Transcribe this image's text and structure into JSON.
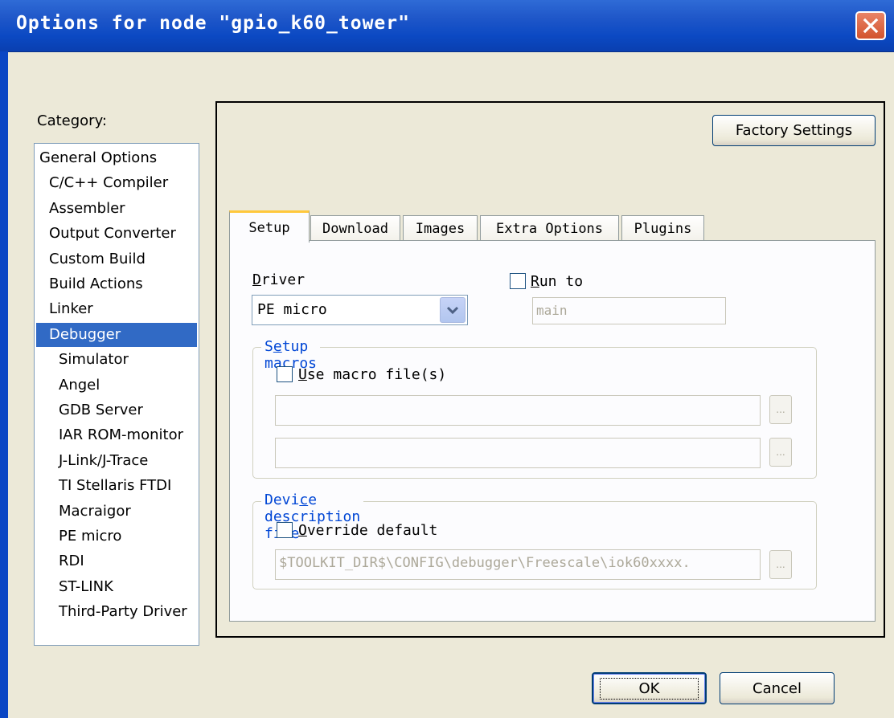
{
  "window": {
    "title": "Options for node \"gpio_k60_tower\""
  },
  "category": {
    "label": "Category:",
    "items": [
      {
        "label": "General Options",
        "indent": 0
      },
      {
        "label": "C/C++ Compiler",
        "indent": 1
      },
      {
        "label": "Assembler",
        "indent": 1
      },
      {
        "label": "Output Converter",
        "indent": 1
      },
      {
        "label": "Custom Build",
        "indent": 1
      },
      {
        "label": "Build Actions",
        "indent": 1
      },
      {
        "label": "Linker",
        "indent": 1
      },
      {
        "label": "Debugger",
        "indent": 1,
        "selected": true
      },
      {
        "label": "Simulator",
        "indent": 2
      },
      {
        "label": "Angel",
        "indent": 2
      },
      {
        "label": "GDB Server",
        "indent": 2
      },
      {
        "label": "IAR ROM-monitor",
        "indent": 2
      },
      {
        "label": "J-Link/J-Trace",
        "indent": 2
      },
      {
        "label": "TI Stellaris FTDI",
        "indent": 2
      },
      {
        "label": "Macraigor",
        "indent": 2
      },
      {
        "label": "PE micro",
        "indent": 2
      },
      {
        "label": "RDI",
        "indent": 2
      },
      {
        "label": "ST-LINK",
        "indent": 2
      },
      {
        "label": "Third-Party Driver",
        "indent": 2
      }
    ]
  },
  "factory_settings_label": "Factory Settings",
  "tabs": [
    {
      "label": "Setup",
      "active": true
    },
    {
      "label": "Download"
    },
    {
      "label": "Images"
    },
    {
      "label": "Extra Options"
    },
    {
      "label": "Plugins"
    }
  ],
  "setup": {
    "driver_label": "Driver",
    "driver_value": "PE micro",
    "run_to_label": "Run to",
    "run_to_checked": false,
    "run_to_value": "main",
    "macros_group": "Setup macros",
    "use_macro_label": "Use macro file(s)",
    "use_macro_checked": false,
    "macro_file_1": "",
    "macro_file_2": "",
    "device_group": "Device description file",
    "override_label": "Override default",
    "override_checked": false,
    "device_file": "$TOOLKIT_DIR$\\CONFIG\\debugger\\Freescale\\iok60xxxx.",
    "browse_label": "..."
  },
  "buttons": {
    "ok": "OK",
    "cancel": "Cancel"
  },
  "colors": {
    "titlebar": "#0b49c3",
    "selection": "#316AC5",
    "group_label": "#0046d5"
  }
}
